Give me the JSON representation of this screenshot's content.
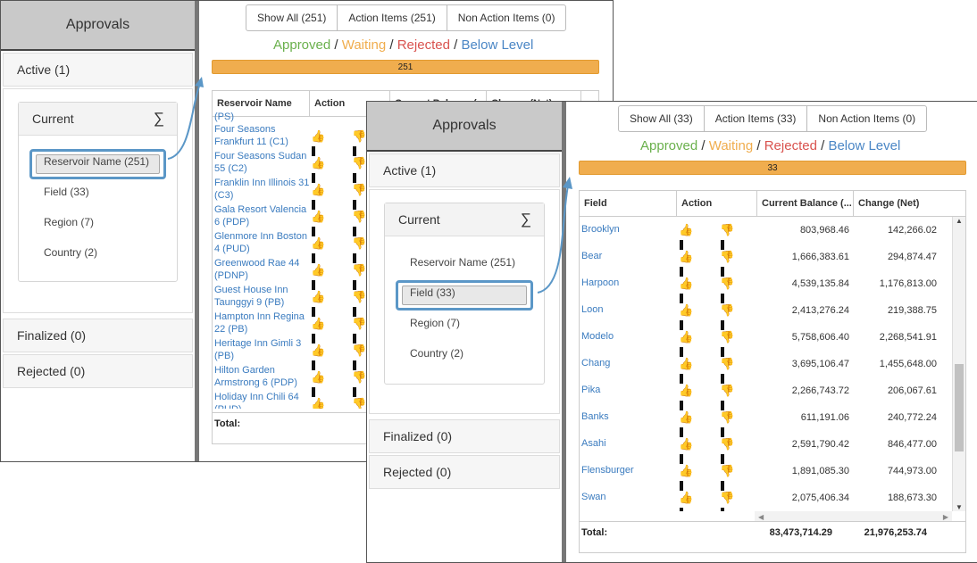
{
  "sidebar": {
    "title": "Approvals",
    "active_label": "Active (1)",
    "current_label": "Current",
    "sigma": "∑",
    "finalized_label": "Finalized (0)",
    "rejected_label": "Rejected (0)"
  },
  "back": {
    "groups": [
      "Reservoir Name (251)",
      "Field (33)",
      "Region (7)",
      "Country (2)"
    ],
    "tabs": [
      "Show All (251)",
      "Action Items (251)",
      "Non Action Items (0)"
    ],
    "bar_value": "251",
    "headers": [
      "Reservoir Name",
      "Action",
      "Current Balance (",
      "Change (Net)"
    ],
    "rows": [
      "(PS)",
      "Four Seasons Frankfurt 11 (C1)",
      "Four Seasons Sudan 55 (C2)",
      "Franklin Inn Illinois 31 (C3)",
      "Gala Resort Valencia 6 (PDP)",
      "Glenmore Inn Boston 4 (PUD)",
      "Greenwood Rae 44 (PDNP)",
      "Guest House Inn Taunggyi 9 (PB)",
      "Hampton Inn Regina 22 (PB)",
      "Heritage Inn Gimli 3 (PB)",
      "Hilton Garden Armstrong 6 (PDP)",
      "Holiday Inn Chili 64 (PUD)"
    ],
    "total_label": "Total:"
  },
  "front": {
    "groups": [
      "Reservoir Name (251)",
      "Field (33)",
      "Region (7)",
      "Country (2)"
    ],
    "tabs": [
      "Show All (33)",
      "Action Items (33)",
      "Non Action Items (0)"
    ],
    "bar_value": "33",
    "headers": [
      "Field",
      "Action",
      "Current Balance (...",
      "Change (Net)"
    ],
    "rows": [
      {
        "name": "Brooklyn",
        "balance": "803,968.46",
        "change": "142,266.02"
      },
      {
        "name": "Bear",
        "balance": "1,666,383.61",
        "change": "294,874.47"
      },
      {
        "name": "Harpoon",
        "balance": "4,539,135.84",
        "change": "1,176,813.00"
      },
      {
        "name": "Loon",
        "balance": "2,413,276.24",
        "change": "219,388.75"
      },
      {
        "name": "Modelo",
        "balance": "5,758,606.40",
        "change": "2,268,541.91"
      },
      {
        "name": "Chang",
        "balance": "3,695,106.47",
        "change": "1,455,648.00"
      },
      {
        "name": "Pika",
        "balance": "2,266,743.72",
        "change": "206,067.61"
      },
      {
        "name": "Banks",
        "balance": "611,191.06",
        "change": "240,772.24"
      },
      {
        "name": "Asahi",
        "balance": "2,591,790.42",
        "change": "846,477.00"
      },
      {
        "name": "Flensburger",
        "balance": "1,891,085.30",
        "change": "744,973.00"
      },
      {
        "name": "Swan",
        "balance": "2,075,406.34",
        "change": "188,673.30"
      }
    ],
    "total_label": "Total:",
    "total_balance": "83,473,714.29",
    "total_change": "21,976,253.74"
  },
  "legend": {
    "approved": "Approved",
    "waiting": "Waiting",
    "rejected": "Rejected",
    "below": "Below Level",
    "sep": "/"
  },
  "colors": {
    "approved": "#6ab04c",
    "waiting": "#f0ad4e",
    "rejected": "#d9534f",
    "below": "#4a86c5",
    "accent": "#5b97c7"
  }
}
